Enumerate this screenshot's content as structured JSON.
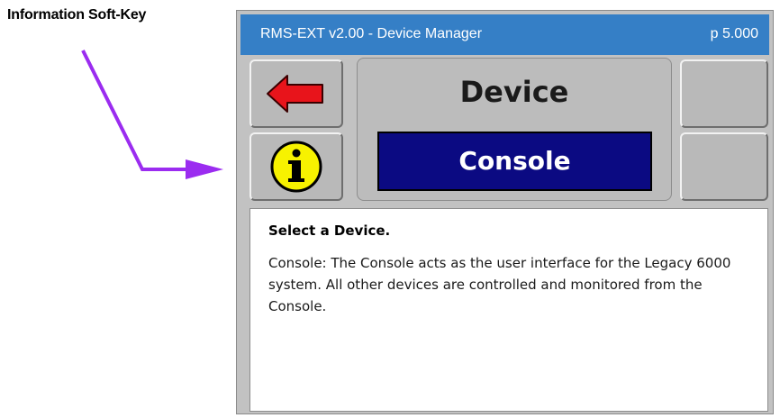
{
  "annotation": {
    "label": "Information Soft-Key",
    "arrow_color": "#9b2cf0"
  },
  "window": {
    "title": "RMS-EXT v2.00 - Device Manager",
    "page": "p 5.000",
    "titlebar_color": "#357fc6"
  },
  "softkeys": {
    "back_icon": "red-left-arrow-icon",
    "info_icon": "yellow-info-icon"
  },
  "selector": {
    "heading": "Device",
    "value": "Console",
    "highlight_color": "#0b0a82"
  },
  "info": {
    "heading": "Select a Device.",
    "body": "Console: The Console acts as the user interface for the Legacy 6000 system.  All other devices are controlled and monitored from the Console."
  }
}
